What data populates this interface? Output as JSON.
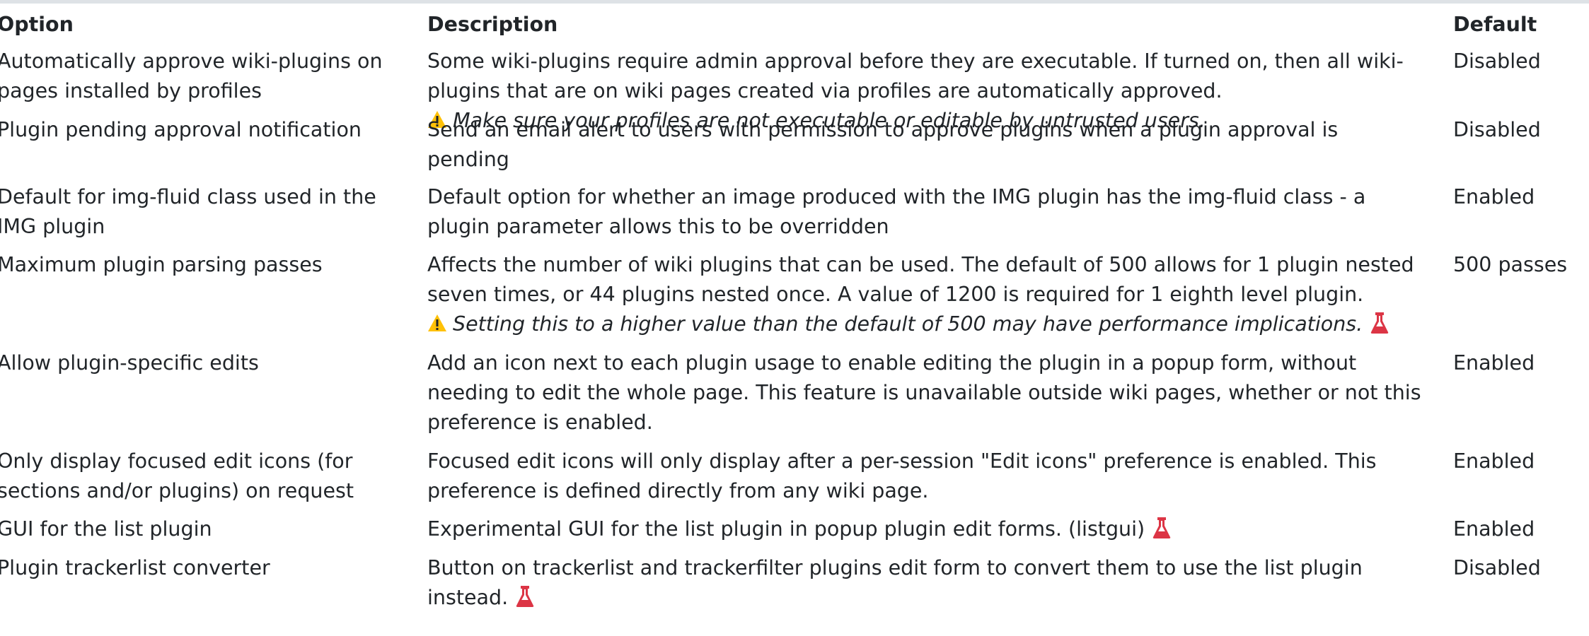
{
  "table": {
    "headers": {
      "option": "Option",
      "description": "Description",
      "default": "Default"
    },
    "rows": [
      {
        "option_lines": [
          "Automatically approve wiki-plugins on",
          "pages installed by profiles"
        ],
        "description_lines": [
          "Some wiki-plugins require admin approval before they are executable. If turned on, then all wiki-",
          "plugins that are on wiki pages created via profiles are automatically approved."
        ],
        "warning": "Make sure your profiles are not executable or editable by untrusted users.",
        "default": "Disabled"
      },
      {
        "option_lines": [
          "Plugin pending approval notification"
        ],
        "description_lines": [
          "Send an email alert to users with permission to approve plugins when a plugin approval is",
          "pending"
        ],
        "default": "Disabled"
      },
      {
        "option_lines": [
          "Default for img-fluid class used in the",
          "IMG plugin"
        ],
        "description_lines": [
          "Default option for whether an image produced with the IMG plugin has the img-fluid class - a",
          "plugin parameter allows this to be overridden"
        ],
        "default": "Enabled"
      },
      {
        "option_lines": [
          "Maximum plugin parsing passes"
        ],
        "description_lines": [
          "Affects the number of wiki plugins that can be used. The default of 500 allows for 1 plugin nested",
          "seven times, or 44 plugins nested once. A value of 1200 is required for 1 eighth level plugin."
        ],
        "warning": "Setting this to a higher value than the default of 500 may have performance implications.",
        "default": "500 passes"
      },
      {
        "option_lines": [
          "Allow plugin-specific edits"
        ],
        "description_lines": [
          "Add an icon next to each plugin usage to enable editing the plugin in a popup form, without",
          "needing to edit the whole page. This feature is unavailable outside wiki pages, whether or not this",
          "preference is enabled."
        ],
        "default": "Enabled"
      },
      {
        "option_lines": [
          "Only display focused edit icons (for",
          "sections and/or plugins) on request"
        ],
        "description_lines": [
          "Focused edit icons will only display after a per-session \"Edit icons\" preference is enabled. This",
          "preference is defined directly from any wiki page."
        ],
        "default": "Enabled"
      },
      {
        "option_lines": [
          "GUI for the list plugin"
        ],
        "description_lines": [
          "Experimental GUI for the list plugin in popup plugin edit forms. (listgui)"
        ],
        "default": "Enabled"
      },
      {
        "option_lines": [
          "Plugin trackerlist converter"
        ],
        "description_lines": [
          "Button on trackerlist and trackerfilter plugins edit form to convert them to use the list plugin",
          "instead."
        ],
        "default": "Disabled"
      }
    ]
  },
  "icons": {
    "warning": "warning-triangle-icon",
    "experimental": "flask-icon"
  },
  "colors": {
    "text": "#212529",
    "warning": "#ffc107",
    "experimental": "#dc3545",
    "border": "#dee2e6"
  }
}
